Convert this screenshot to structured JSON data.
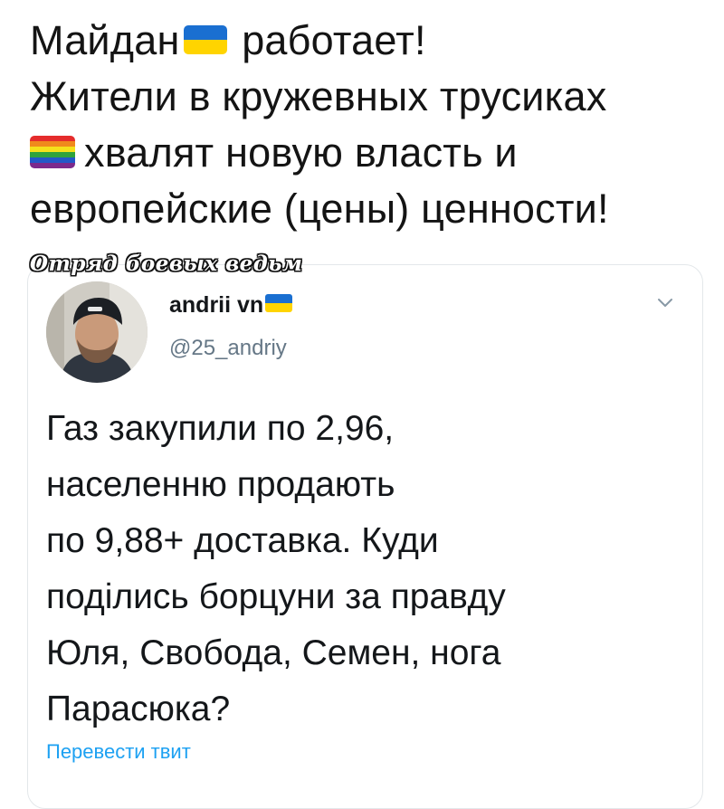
{
  "caption": {
    "line1_before": "Майдан",
    "line1_after": "работает!",
    "line2": "Жители в кружевных трусиках",
    "line3": "хвалят новую власть и",
    "line4": "европейские (цены) ценности!"
  },
  "watermark": "Отряд боевых ведьм",
  "tweet": {
    "user_name": "andrii vn",
    "user_handle": "@25_andriy",
    "text_lines": [
      "Газ закупили по 2,96,",
      "населенню продають",
      "по 9,88+ доставка. Куди",
      "поділись борцуни за правду",
      "Юля, Свобода, Семен, нога",
      "Парасюка?"
    ],
    "translate_label": "Перевести твит"
  },
  "colors": {
    "ua_blue": "#1a6fd1",
    "ua_yellow": "#ffd400",
    "link": "#1da1f2",
    "muted": "#657786"
  },
  "icons": [
    "ukraine-flag-icon",
    "rainbow-flag-icon",
    "chevron-down-icon"
  ]
}
